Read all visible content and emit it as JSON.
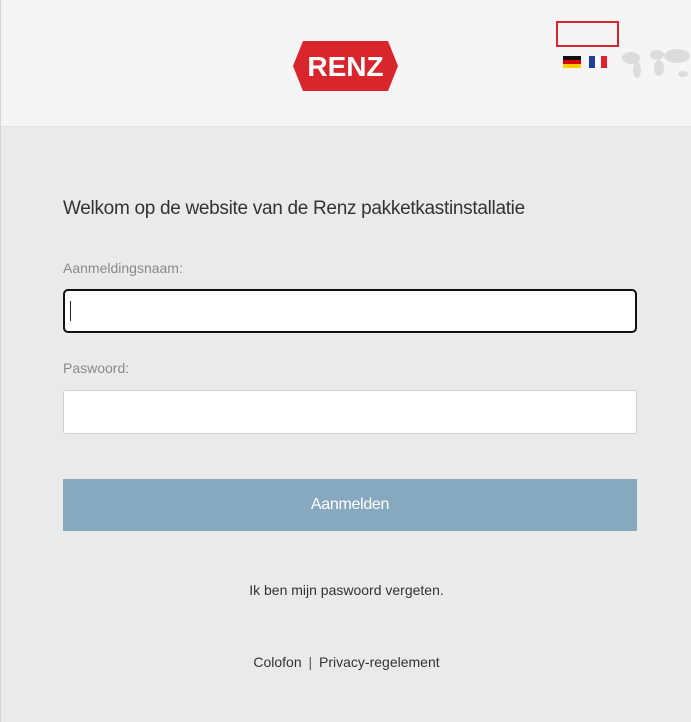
{
  "header": {
    "logo_text": "RENZ",
    "brand_color": "#d9262c",
    "languages": [
      {
        "code": "de",
        "icon": "german-flag-icon"
      },
      {
        "code": "fr",
        "icon": "french-flag-icon"
      }
    ],
    "decoration_icon": "world-map-icon"
  },
  "login": {
    "welcome": "Welkom op de website van de Renz pakketkastinstallatie",
    "username_label": "Aanmeldingsnaam:",
    "username_value": "",
    "password_label": "Paswoord:",
    "password_value": "",
    "submit_label": "Aanmelden",
    "submit_color": "#87a9c0"
  },
  "links": {
    "forgot": "Ik ben mijn paswoord vergeten.",
    "colofon": "Colofon",
    "separator": "|",
    "privacy": "Privacy-regelement"
  }
}
